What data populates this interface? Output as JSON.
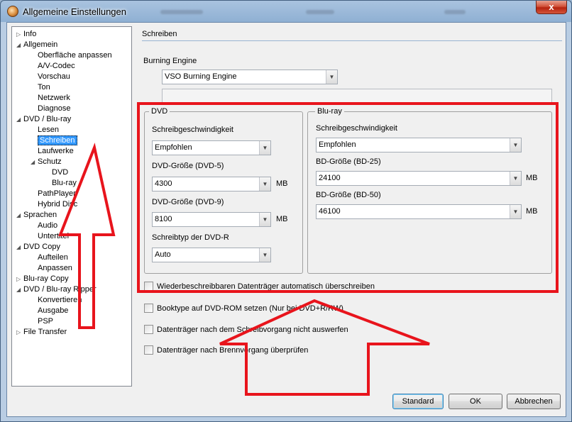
{
  "window": {
    "title": "Allgemeine Einstellungen",
    "close_label": "x"
  },
  "tree": {
    "items": [
      {
        "label": "Info",
        "expander": "▷"
      },
      {
        "label": "Allgemein",
        "expander": "◢"
      },
      {
        "label": "Oberfläche anpassen",
        "expander": ""
      },
      {
        "label": "A/V-Codec",
        "expander": ""
      },
      {
        "label": "Vorschau",
        "expander": ""
      },
      {
        "label": "Ton",
        "expander": ""
      },
      {
        "label": "Netzwerk",
        "expander": ""
      },
      {
        "label": "Diagnose",
        "expander": ""
      },
      {
        "label": "DVD / Blu-ray",
        "expander": "◢"
      },
      {
        "label": "Lesen",
        "expander": ""
      },
      {
        "label": "Schreiben",
        "expander": ""
      },
      {
        "label": "Laufwerke",
        "expander": ""
      },
      {
        "label": "Schutz",
        "expander": "◢"
      },
      {
        "label": "DVD",
        "expander": ""
      },
      {
        "label": "Blu-ray",
        "expander": ""
      },
      {
        "label": "PathPlayer",
        "expander": ""
      },
      {
        "label": "Hybrid Disc",
        "expander": ""
      },
      {
        "label": "Sprachen",
        "expander": "◢"
      },
      {
        "label": "Audio",
        "expander": ""
      },
      {
        "label": "Untertitel",
        "expander": ""
      },
      {
        "label": "DVD Copy",
        "expander": "◢"
      },
      {
        "label": "Aufteilen",
        "expander": ""
      },
      {
        "label": "Anpassen",
        "expander": ""
      },
      {
        "label": "Blu-ray Copy",
        "expander": "▷"
      },
      {
        "label": "DVD / Blu-ray Ripper",
        "expander": "◢"
      },
      {
        "label": "Konvertieren",
        "expander": ""
      },
      {
        "label": "Ausgabe",
        "expander": ""
      },
      {
        "label": "PSP",
        "expander": ""
      },
      {
        "label": "File Transfer",
        "expander": "▷"
      }
    ],
    "selected": "Schreiben"
  },
  "panel": {
    "section_title": "Schreiben",
    "burning_engine_label": "Burning Engine",
    "burning_engine_value": "VSO Burning Engine",
    "dvd_group": {
      "caption": "DVD",
      "speed_label": "Schreibgeschwindigkeit",
      "speed_value": "Empfohlen",
      "dvd5_label": "DVD-Größe (DVD-5)",
      "dvd5_value": "4300",
      "dvd5_unit": "MB",
      "dvd9_label": "DVD-Größe (DVD-9)",
      "dvd9_value": "8100",
      "dvd9_unit": "MB",
      "type_label": "Schreibtyp der DVD-R",
      "type_value": "Auto"
    },
    "bluray_group": {
      "caption": "Blu-ray",
      "speed_label": "Schreibgeschwindigkeit",
      "speed_value": "Empfohlen",
      "bd25_label": "BD-Größe (BD-25)",
      "bd25_value": "24100",
      "bd25_unit": "MB",
      "bd50_label": "BD-Größe (BD-50)",
      "bd50_value": "46100",
      "bd50_unit": "MB"
    },
    "checkboxes": [
      {
        "label": "Wiederbeschreibbaren Datenträger automatisch überschreiben",
        "checked": false
      },
      {
        "label": "Booktype auf DVD-ROM setzen (Nur bei DVD+R/RW)",
        "checked": false
      },
      {
        "label": "Datenträger nach dem Schreibvorgang nicht auswerfen",
        "checked": false
      },
      {
        "label": "Datenträger nach Brennvorgang überprüfen",
        "checked": false
      }
    ]
  },
  "buttons": {
    "standard": "Standard",
    "ok": "OK",
    "cancel": "Abbrechen"
  },
  "colors": {
    "annotation": "#e8141c",
    "selection": "#3399ff"
  }
}
